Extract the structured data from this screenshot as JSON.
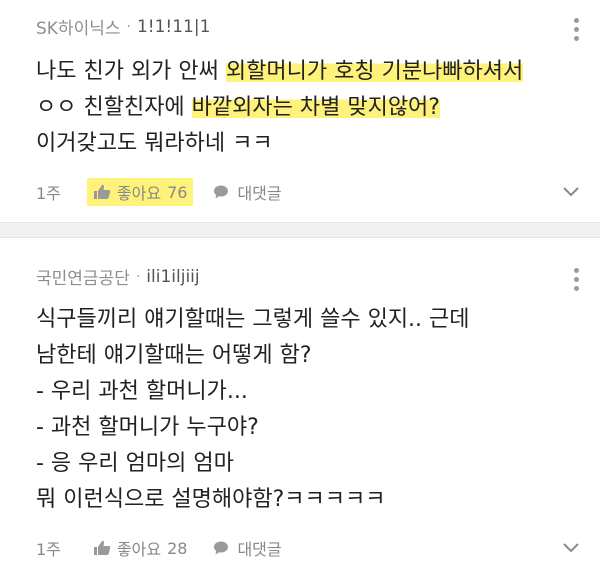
{
  "comments": [
    {
      "author": "SK하이닉스",
      "user_id": "1!1!11|1",
      "lines": [
        {
          "plain": "나도 친가 외가 안써 ",
          "highlight": "외할머니가 호칭 기분나빠하셔서"
        },
        {
          "plain": "ㅇㅇ 친할친자에 ",
          "highlight": "바깥외자는 차별 맞지않어?"
        },
        {
          "plain": "이거갖고도 뭐라하네 ㅋㅋ",
          "highlight": ""
        }
      ],
      "time": "1주",
      "like_label": "좋아요",
      "like_count": "76",
      "reply_label": "대댓글"
    },
    {
      "author": "국민연금공단",
      "user_id": "ili1iljiij",
      "lines": [
        "식구들끼리 얘기할때는 그렇게 쓸수 있지.. 근데",
        "남한테 얘기할때는 어떻게 함?",
        "- 우리 과천 할머니가...",
        "- 과천 할머니가 누구야?",
        "- 응 우리 엄마의 엄마",
        "뭐 이런식으로 설명해야함?ㅋㅋㅋㅋㅋ"
      ],
      "time": "1주",
      "like_label": "좋아요",
      "like_count": "28",
      "reply_label": "대댓글"
    }
  ],
  "icons": {
    "like": "thumbs-up-icon",
    "reply": "speech-bubble-icon",
    "more": "more-vertical-icon",
    "expand": "chevron-down-icon"
  },
  "colors": {
    "highlight": "#fff27a",
    "muted": "#8e8e8e",
    "separator": "#f1f1f1"
  }
}
